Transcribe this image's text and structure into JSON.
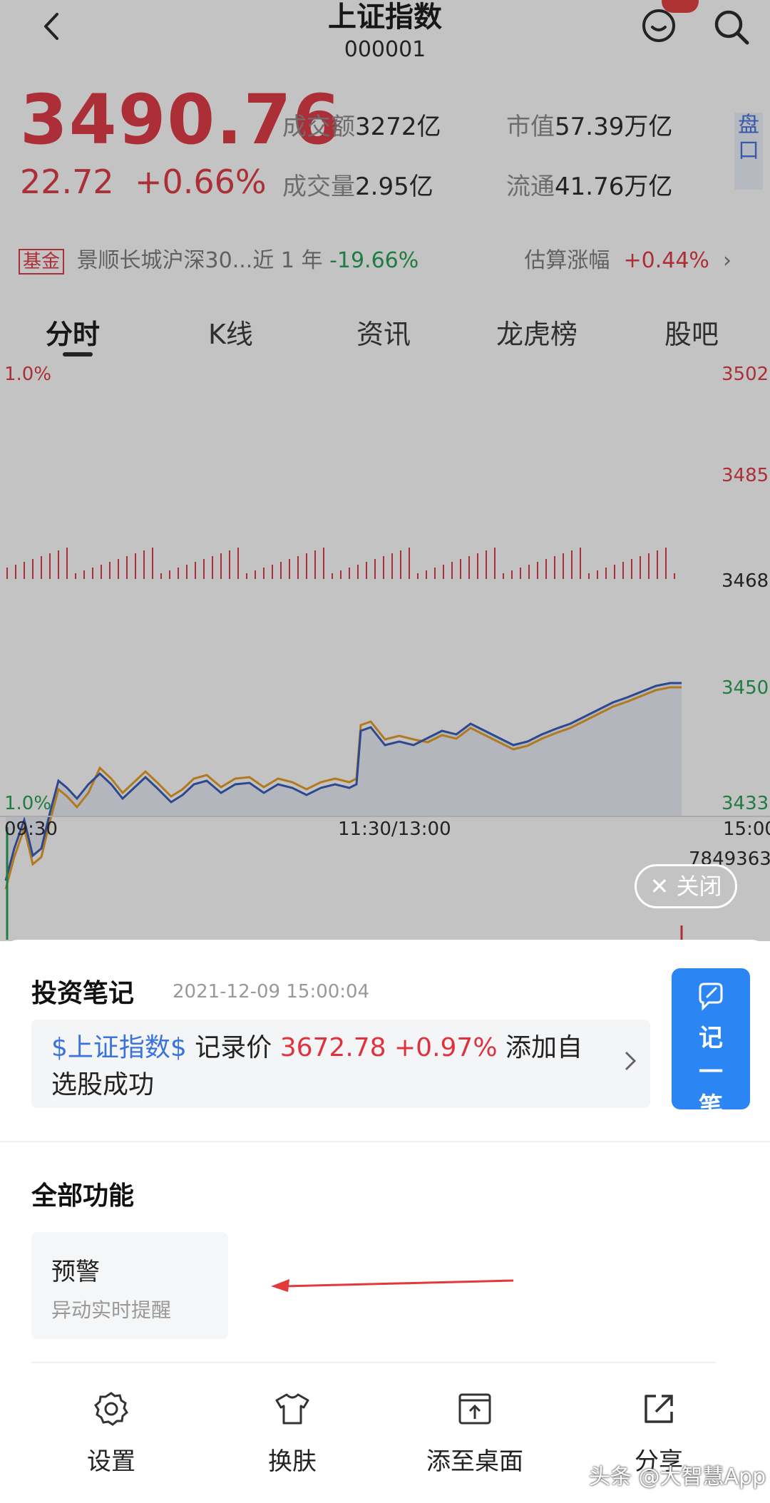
{
  "header": {
    "title": "上证指数",
    "code": "000001",
    "badge": "···"
  },
  "quote": {
    "price": "3490.76",
    "change": "22.72",
    "change_pct": "+0.66%",
    "turnover_label": "成交额",
    "turnover_value": "3272亿",
    "volume_label": "成交量",
    "volume_value": "2.95亿",
    "mktcap_label": "市值",
    "mktcap_value": "57.39万亿",
    "float_label": "流通",
    "float_value": "41.76万亿",
    "pankou": "盘口"
  },
  "fund": {
    "tag": "基金",
    "name": "景顺长城沪深30...近 1 年",
    "return": "-19.66%",
    "est_label": "估算涨幅",
    "est_value": "+0.44%"
  },
  "tabs": [
    "分时",
    "K线",
    "资讯",
    "龙虎榜",
    "股吧"
  ],
  "chart": {
    "pct_top": "1.0%",
    "pct_bottom": "1.0%",
    "price_ticks": [
      "3502",
      "3485",
      "3468",
      "3450",
      "3433"
    ],
    "time_ticks": [
      "09:30",
      "11:30/13:00",
      "15:00"
    ],
    "volume_max": "7849363",
    "colors": {
      "price_line": "#2f55b8",
      "avg_line": "#e89a1b",
      "up": "#e0323d",
      "down": "#1e9d4d"
    }
  },
  "close_button": "关闭",
  "note": {
    "title": "投资笔记",
    "time": "2021-12-09 15:00:04",
    "tag": "$上证指数$",
    "record_label": " 记录价 ",
    "record_value": "3672.78 +0.97%",
    "suffix": " 添加自选股成功",
    "write_label_1": "记",
    "write_label_2": "一",
    "write_label_3": "笔"
  },
  "functions": {
    "title": "全部功能",
    "card_title": "预警",
    "card_sub": "异动实时提醒"
  },
  "bottom_bar": [
    "设置",
    "换肤",
    "添至桌面",
    "分享"
  ],
  "watermark": "头条 @大智慧App"
}
